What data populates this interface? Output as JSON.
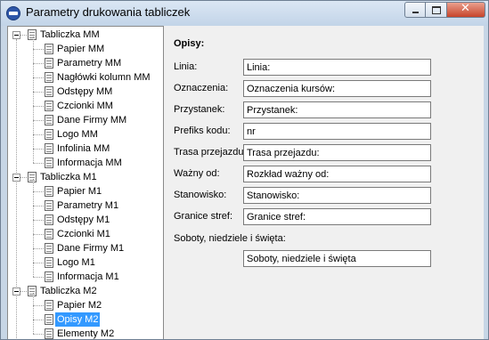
{
  "window": {
    "title": "Parametry drukowania tabliczek"
  },
  "tree": {
    "groups": [
      {
        "label": "Tabliczka MM",
        "items": [
          "Papier MM",
          "Parametry MM",
          "Nagłówki kolumn MM",
          "Odstępy MM",
          "Czcionki MM",
          "Dane Firmy MM",
          "Logo MM",
          "Infolinia MM",
          "Informacja MM"
        ]
      },
      {
        "label": "Tabliczka M1",
        "items": [
          "Papier M1",
          "Parametry M1",
          "Odstępy M1",
          "Czcionki M1",
          "Dane Firmy M1",
          "Logo M1",
          "Informacja M1"
        ]
      },
      {
        "label": "Tabliczka M2",
        "items": [
          "Papier M2",
          "Opisy M2",
          "Elementy M2"
        ]
      }
    ],
    "selected": "Opisy M2"
  },
  "form": {
    "heading": "Opisy:",
    "fields": [
      {
        "label": "Linia:",
        "value": "Linia:"
      },
      {
        "label": "Oznaczenia:",
        "value": "Oznaczenia kursów:"
      },
      {
        "label": "Przystanek:",
        "value": "Przystanek:"
      },
      {
        "label": "Prefiks kodu:",
        "value": "nr"
      },
      {
        "label": "Trasa przejazdu:",
        "value": "Trasa przejazdu:"
      },
      {
        "label": "Ważny od:",
        "value": "Rozkład ważny od:"
      },
      {
        "label": "Stanowisko:",
        "value": "Stanowisko:"
      },
      {
        "label": "Granice stref:",
        "value": "Granice stref:"
      }
    ],
    "weekend": {
      "label": "Soboty, niedziele i święta:",
      "value": "Soboty, niedziele i święta"
    }
  }
}
